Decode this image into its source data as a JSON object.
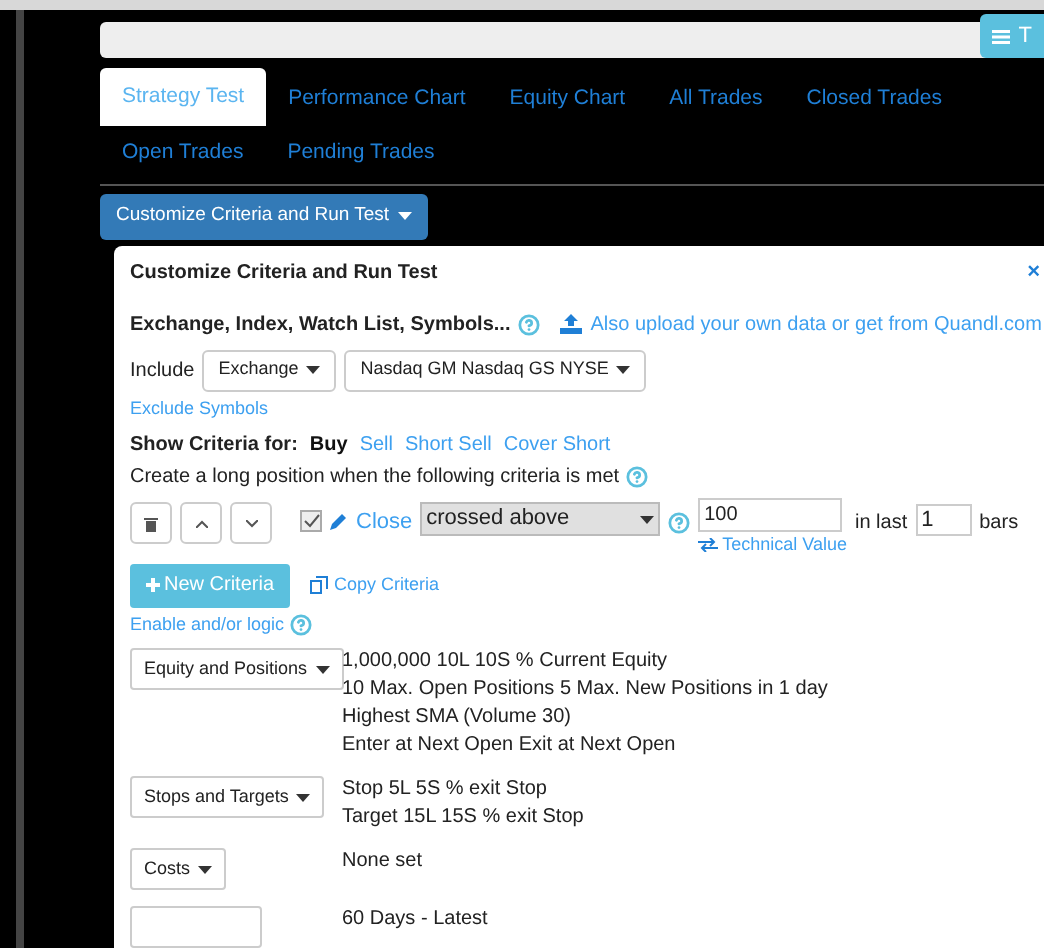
{
  "top_button": {
    "label": "T"
  },
  "tabs": [
    {
      "label": "Strategy Test",
      "selected": true
    },
    {
      "label": "Performance Chart",
      "selected": false
    },
    {
      "label": "Equity Chart",
      "selected": false
    },
    {
      "label": "All Trades",
      "selected": false
    },
    {
      "label": "Closed Trades",
      "selected": false
    },
    {
      "label": "Open Trades",
      "selected": false
    },
    {
      "label": "Pending Trades",
      "selected": false
    }
  ],
  "customize_button": {
    "label": "Customize Criteria and Run Test"
  },
  "panel": {
    "title": "Customize Criteria and Run Test",
    "close": "×",
    "universe": {
      "heading": "Exchange, Index, Watch List, Symbols...",
      "upload_link": "Also upload your own data or get from Quandl.com",
      "include_label": "Include",
      "type_dropdown": "Exchange",
      "exchanges_dropdown": "Nasdaq GM Nasdaq GS NYSE",
      "exclude_link": "Exclude Symbols"
    },
    "show_criteria": {
      "label": "Show Criteria for:",
      "options": [
        {
          "label": "Buy",
          "selected": true
        },
        {
          "label": "Sell",
          "selected": false
        },
        {
          "label": "Short Sell",
          "selected": false
        },
        {
          "label": "Cover Short",
          "selected": false
        }
      ]
    },
    "criteria_intro": "Create a long position when the following criteria is met",
    "criterion": {
      "checked": true,
      "field": "Close",
      "operator": "crossed above",
      "value": "100",
      "value_type": "Technical Value",
      "in_last_label": "in last",
      "bars_value": "1",
      "bars_label": "bars"
    },
    "new_criteria_button": "New Criteria",
    "copy_criteria_link": "Copy Criteria",
    "logic_link": "Enable and/or logic",
    "settings": [
      {
        "button": "Equity and Positions",
        "lines": [
          "1,000,000 10L 10S % Current Equity",
          "10 Max. Open Positions 5 Max. New Positions in 1 day",
          "Highest SMA (Volume 30)",
          "Enter at Next Open Exit at Next Open"
        ]
      },
      {
        "button": "Stops and Targets",
        "lines": [
          "Stop 5L 5S % exit Stop",
          "Target 15L 15S % exit Stop"
        ]
      },
      {
        "button": "Costs",
        "lines": [
          "None set"
        ]
      },
      {
        "lines": [
          "60 Days - Latest"
        ]
      }
    ]
  }
}
